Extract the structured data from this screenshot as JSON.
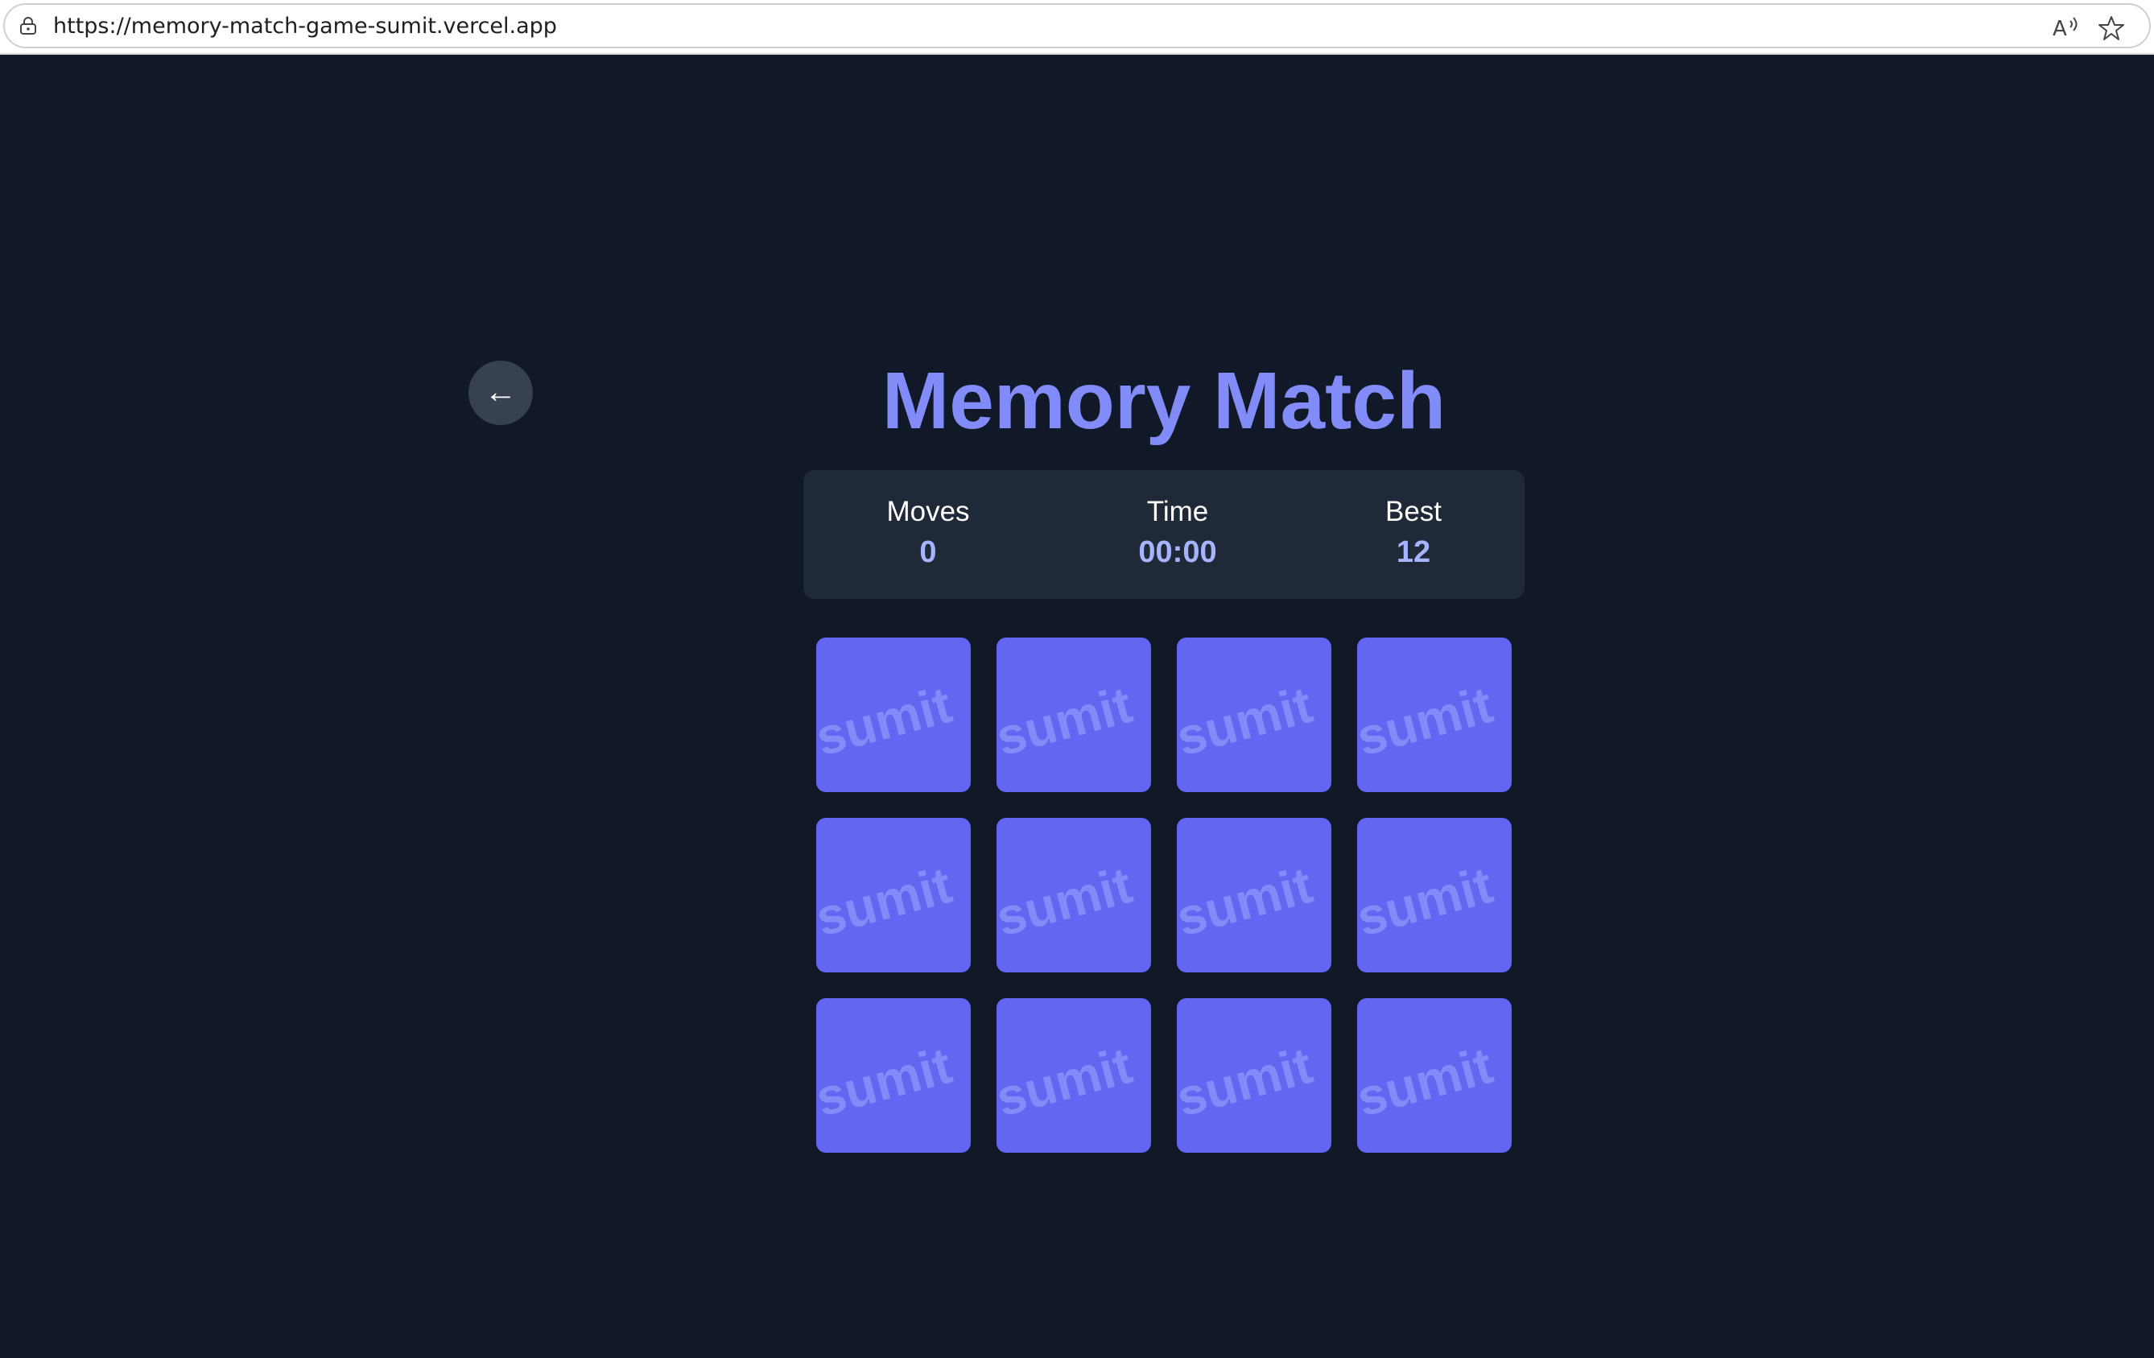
{
  "browser": {
    "url": "https://memory-match-game-sumit.vercel.app",
    "icons": [
      "lock-icon",
      "read-aloud-icon",
      "star-icon"
    ]
  },
  "game": {
    "back_label": "←",
    "title": "Memory Match",
    "stats": {
      "moves_label": "Moves",
      "moves_value": "0",
      "time_label": "Time",
      "time_value": "00:00",
      "best_label": "Best",
      "best_value": "12"
    },
    "cards": [
      {
        "back_text": "sumit"
      },
      {
        "back_text": "sumit"
      },
      {
        "back_text": "sumit"
      },
      {
        "back_text": "sumit"
      },
      {
        "back_text": "sumit"
      },
      {
        "back_text": "sumit"
      },
      {
        "back_text": "sumit"
      },
      {
        "back_text": "sumit"
      },
      {
        "back_text": "sumit"
      },
      {
        "back_text": "sumit"
      },
      {
        "back_text": "sumit"
      },
      {
        "back_text": "sumit"
      }
    ]
  },
  "colors": {
    "background": "#111827",
    "accent": "#818cf8",
    "card": "#6366f1",
    "panel": "#1f2937",
    "stat_value": "#a5b4fc"
  }
}
